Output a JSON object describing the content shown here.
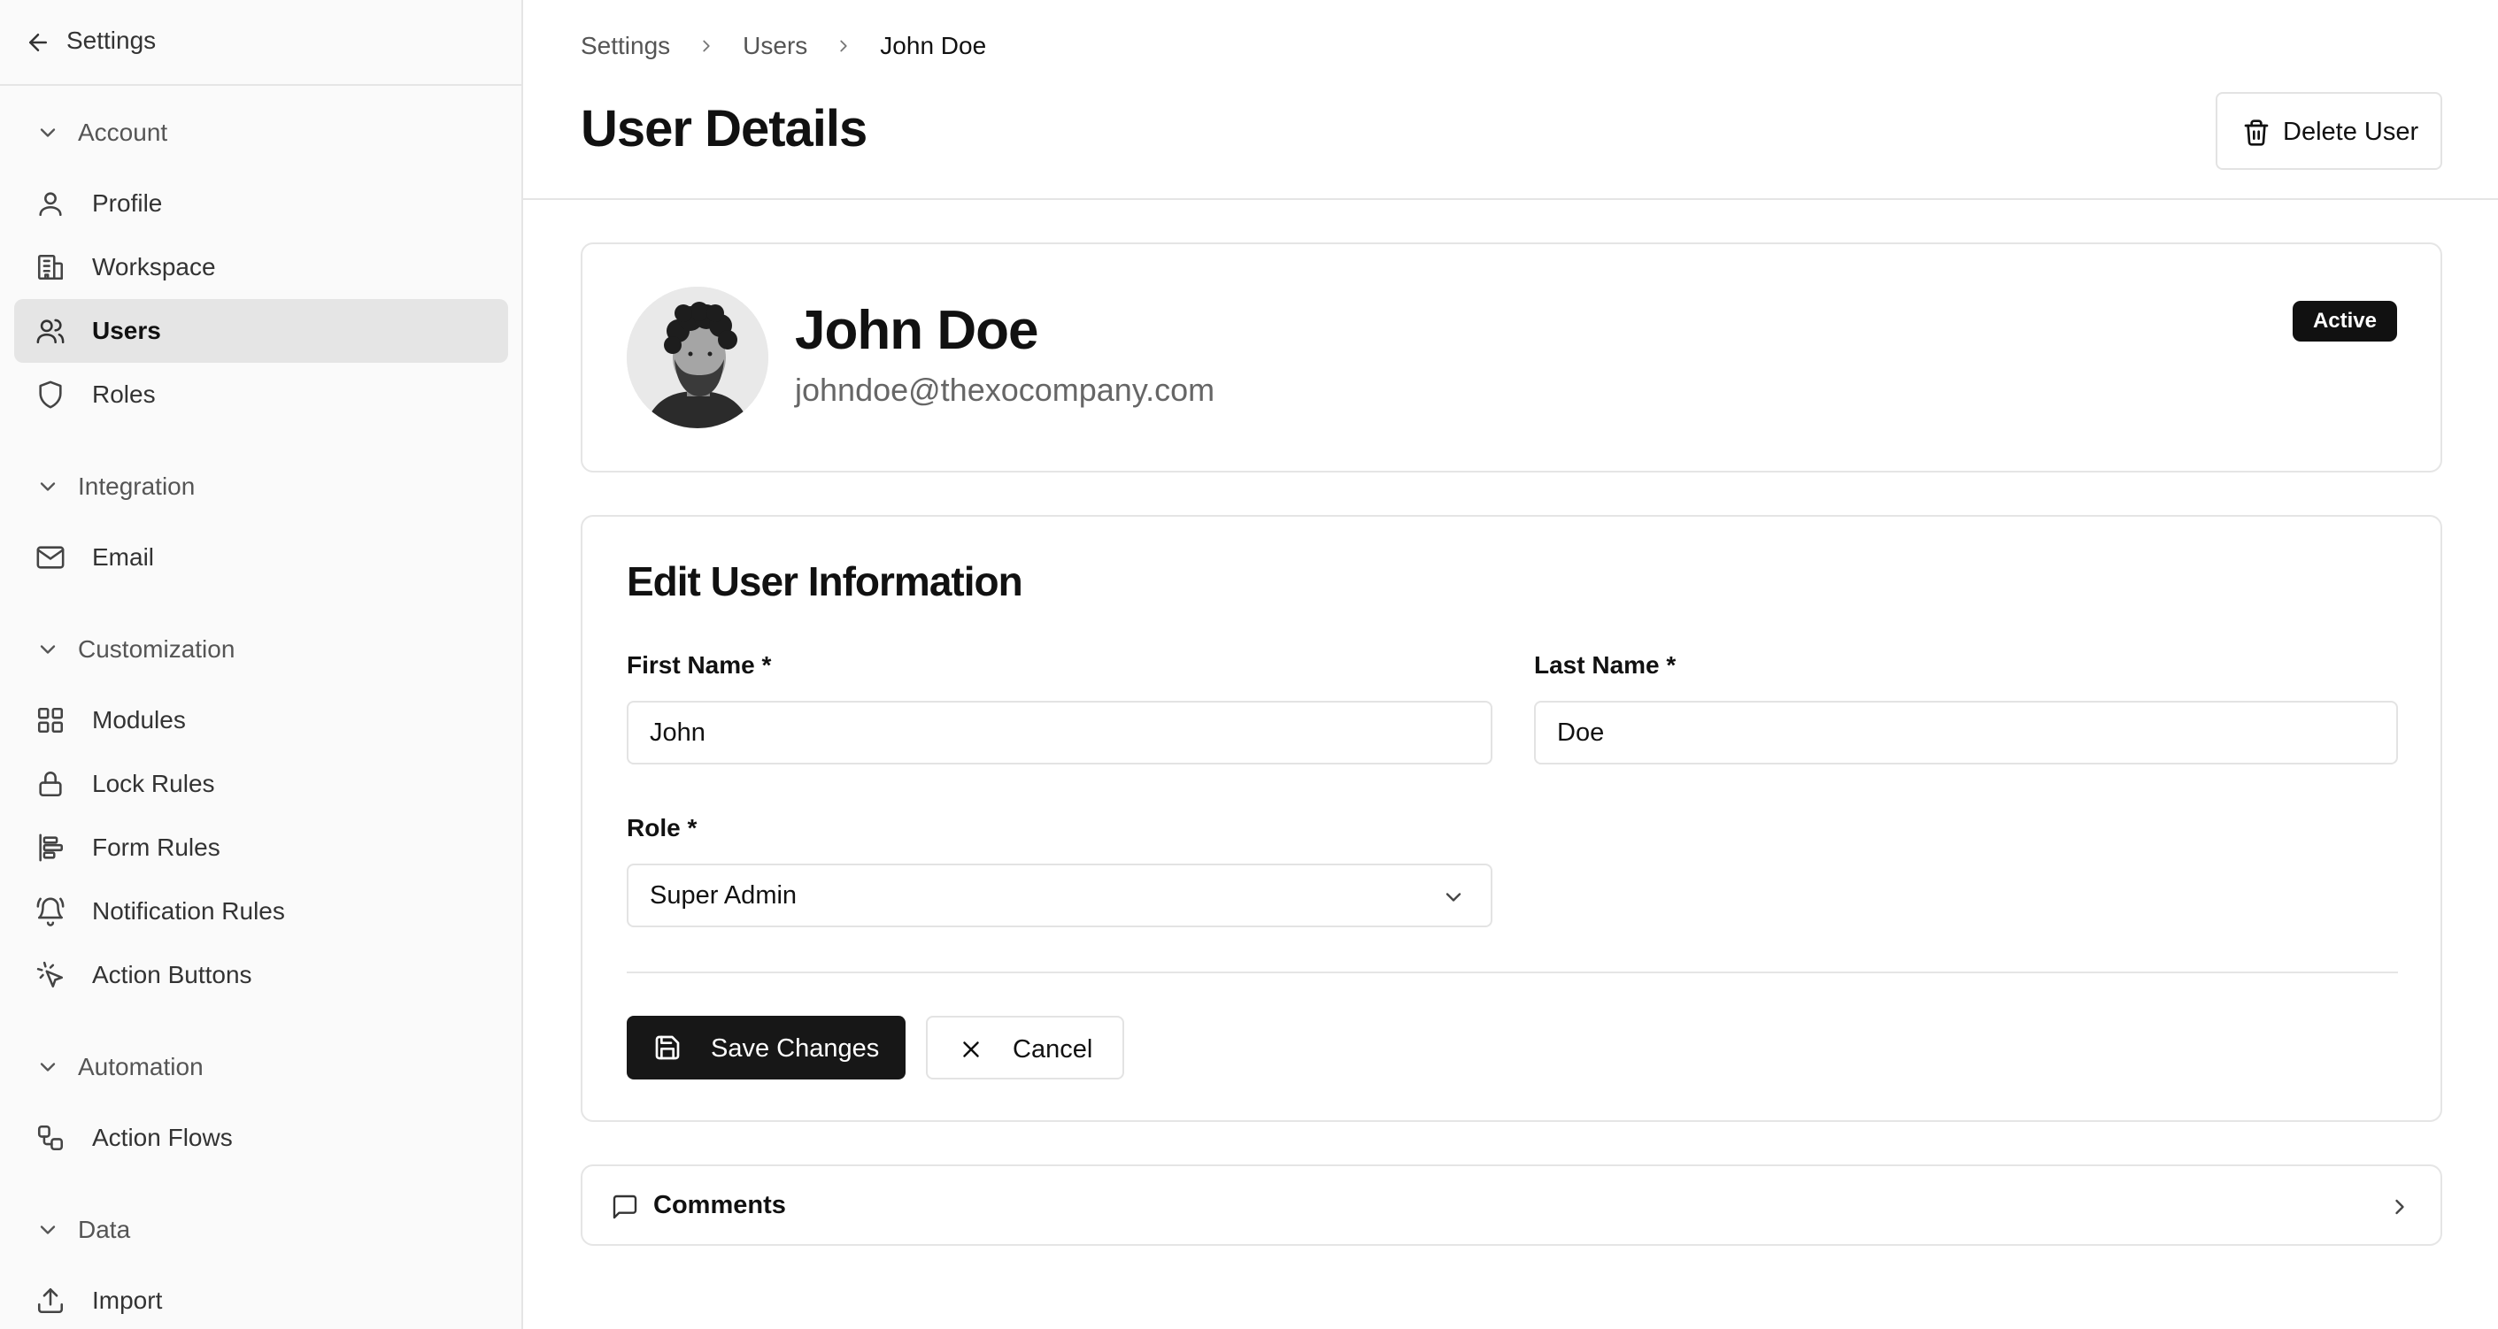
{
  "sidebar": {
    "back_label": "Settings",
    "groups": [
      {
        "label": "Account",
        "items": [
          {
            "label": "Profile",
            "icon": "user-icon"
          },
          {
            "label": "Workspace",
            "icon": "building-icon"
          },
          {
            "label": "Users",
            "icon": "users-icon",
            "active": true
          },
          {
            "label": "Roles",
            "icon": "shield-icon"
          }
        ]
      },
      {
        "label": "Integration",
        "items": [
          {
            "label": "Email",
            "icon": "mail-icon"
          }
        ]
      },
      {
        "label": "Customization",
        "items": [
          {
            "label": "Modules",
            "icon": "grid-icon"
          },
          {
            "label": "Lock Rules",
            "icon": "lock-icon"
          },
          {
            "label": "Form Rules",
            "icon": "align-left-icon"
          },
          {
            "label": "Notification Rules",
            "icon": "bell-icon"
          },
          {
            "label": "Action Buttons",
            "icon": "cursor-click-icon"
          }
        ]
      },
      {
        "label": "Automation",
        "items": [
          {
            "label": "Action Flows",
            "icon": "workflow-icon"
          }
        ]
      },
      {
        "label": "Data",
        "items": [
          {
            "label": "Import",
            "icon": "upload-icon"
          }
        ]
      }
    ]
  },
  "breadcrumb": [
    "Settings",
    "Users",
    "John Doe"
  ],
  "header": {
    "title": "User Details",
    "delete_label": "Delete User"
  },
  "profile": {
    "name": "John Doe",
    "email": "johndoe@thexocompany.com",
    "status": "Active"
  },
  "form": {
    "title": "Edit User Information",
    "first_name_label": "First Name *",
    "first_name_value": "John",
    "last_name_label": "Last Name *",
    "last_name_value": "Doe",
    "role_label": "Role *",
    "role_value": "Super Admin",
    "save_label": "Save Changes",
    "cancel_label": "Cancel"
  },
  "comments": {
    "label": "Comments"
  },
  "colors": {
    "primary": "#171717",
    "active_bg": "#e5e5e5",
    "border": "#e5e5e5"
  }
}
